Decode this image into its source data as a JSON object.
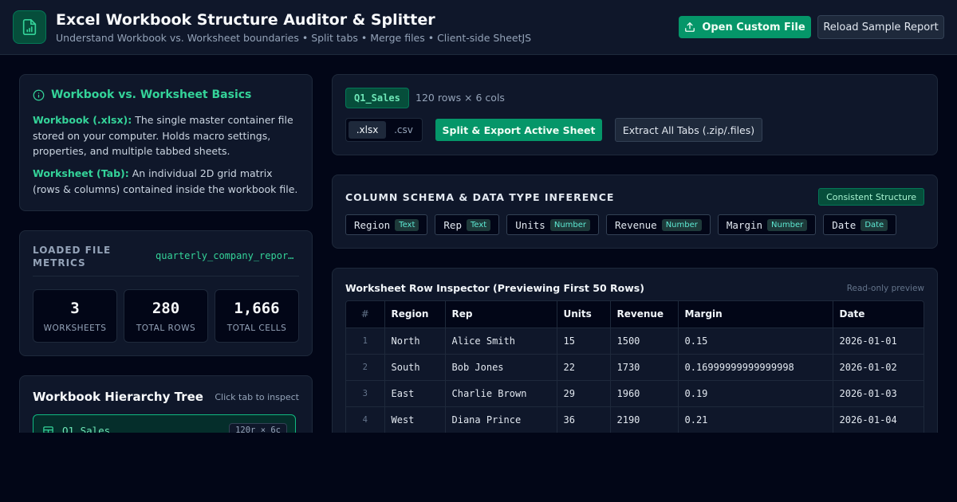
{
  "header": {
    "title": "Excel Workbook Structure Auditor & Splitter",
    "subtitle": "Understand Workbook vs. Worksheet boundaries • Split tabs • Merge files • Client-side SheetJS",
    "open_button": "Open Custom File",
    "reload_button": "Reload Sample Report",
    "logo_icon": "spreadsheet-file-icon"
  },
  "basics": {
    "title": "Workbook vs. Worksheet Basics",
    "workbook_term": "Workbook (.xlsx):",
    "workbook_desc": " The single master container file stored on your computer. Holds macro settings, properties, and multiple tabbed sheets.",
    "worksheet_term": "Worksheet (Tab):",
    "worksheet_desc": " An individual 2D grid matrix (rows & columns) contained inside the workbook file."
  },
  "metrics": {
    "label": "LOADED FILE METRICS",
    "filename": "quarterly_company_report.xlsx",
    "stats": [
      {
        "value": "3",
        "label": "WORKSHEETS"
      },
      {
        "value": "280",
        "label": "TOTAL ROWS"
      },
      {
        "value": "1,666",
        "label": "TOTAL CELLS"
      }
    ]
  },
  "tree": {
    "title": "Workbook Hierarchy Tree",
    "hint": "Click tab to inspect",
    "items": [
      {
        "name": "Q1_Sales",
        "dims": "120r × 6c"
      }
    ]
  },
  "active_sheet": {
    "name": "Q1_Sales",
    "dims": "120 rows × 6 cols",
    "formats": [
      ".xlsx",
      ".csv"
    ],
    "split_button": "Split & Export Active Sheet",
    "extract_button": "Extract All Tabs (.zip/.files)"
  },
  "schema": {
    "title": "COLUMN SCHEMA & DATA TYPE INFERENCE",
    "status": "Consistent Structure",
    "columns": [
      {
        "name": "Region",
        "type": "Text"
      },
      {
        "name": "Rep",
        "type": "Text"
      },
      {
        "name": "Units",
        "type": "Number"
      },
      {
        "name": "Revenue",
        "type": "Number"
      },
      {
        "name": "Margin",
        "type": "Number"
      },
      {
        "name": "Date",
        "type": "Date"
      }
    ]
  },
  "inspector": {
    "title": "Worksheet Row Inspector (Previewing First 50 Rows)",
    "hint": "Read-only preview",
    "headers": [
      "#",
      "Region",
      "Rep",
      "Units",
      "Revenue",
      "Margin",
      "Date"
    ],
    "rows": [
      [
        "1",
        "North",
        "Alice Smith",
        "15",
        "1500",
        "0.15",
        "2026-01-01"
      ],
      [
        "2",
        "South",
        "Bob Jones",
        "22",
        "1730",
        "0.16999999999999998",
        "2026-01-02"
      ],
      [
        "3",
        "East",
        "Charlie Brown",
        "29",
        "1960",
        "0.19",
        "2026-01-03"
      ],
      [
        "4",
        "West",
        "Diana Prince",
        "36",
        "2190",
        "0.21",
        "2026-01-04"
      ]
    ]
  },
  "colors": {
    "accent": "#10b981",
    "background": "#020617",
    "panel": "#0f172a"
  }
}
